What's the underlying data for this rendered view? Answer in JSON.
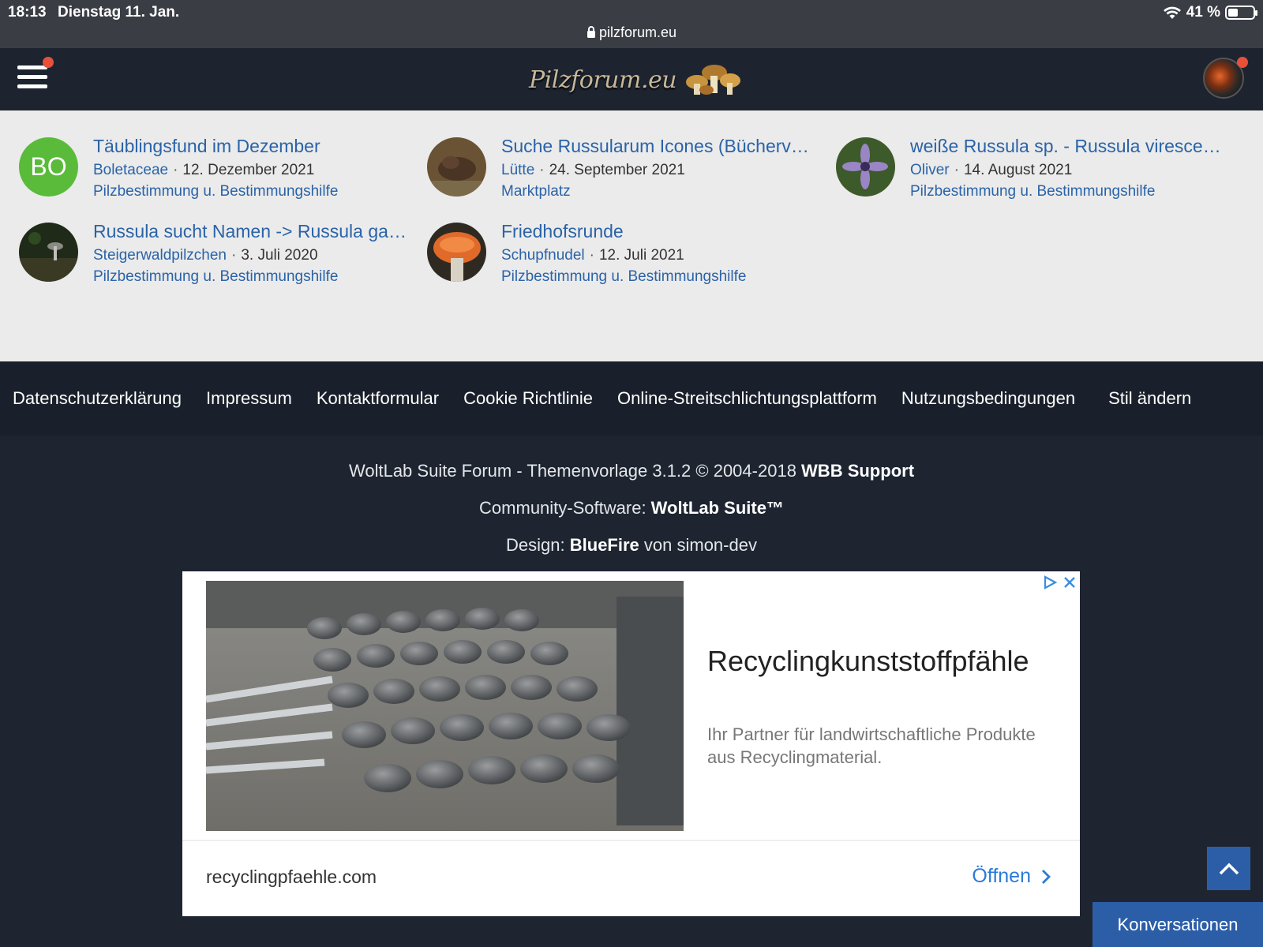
{
  "status_bar": {
    "time": "18:13",
    "date": "Dienstag 11. Jan.",
    "url": "pilzforum.eu",
    "battery": "41 %",
    "battery_level": 0.41
  },
  "header": {
    "logo_text": "Pilzforum.eu"
  },
  "threads": [
    {
      "initials": "BO",
      "title": "Täublingsfund im Dezember",
      "author": "Boletaceae",
      "date": "12. Dezember 2021",
      "board": "Pilzbestimmung u. Bestimmungshilfe"
    },
    {
      "title": "Suche Russularum Icones (Bücherver...",
      "author": "Lütte",
      "date": "24. September 2021",
      "board": "Marktplatz"
    },
    {
      "title": "weiße Russula sp. - Russula virescens...",
      "author": "Oliver",
      "date": "14. August 2021",
      "board": "Pilzbestimmung u. Bestimmungshilfe"
    },
    {
      "title": "Russula sucht Namen -> Russula galo...",
      "author": "Steigerwaldpilzchen",
      "date": "3. Juli 2020",
      "board": "Pilzbestimmung u. Bestimmungshilfe"
    },
    {
      "title": "Friedhofsrunde",
      "author": "Schupfnudel",
      "date": "12. Juli 2021",
      "board": "Pilzbestimmung u. Bestimmungshilfe"
    }
  ],
  "footer_links": [
    "Datenschutzerklärung",
    "Impressum",
    "Kontaktformular",
    "Cookie Richtlinie",
    "Online-Streitschlichtungsplattform",
    "Nutzungsbedingungen",
    "Stil ändern"
  ],
  "copyright": {
    "line1_prefix": "WoltLab Suite Forum - Themenvorlage 3.1.2 © 2004-2018 ",
    "line1_bold": "WBB Support",
    "line2_prefix": "Community-Software: ",
    "line2_bold": "WoltLab Suite™",
    "line3_prefix": "Design: ",
    "line3_bold": "BlueFire",
    "line3_suffix": " von simon-dev"
  },
  "ad": {
    "headline": "Recyclingkunststoffpfähle",
    "description": "Ihr Partner für landwirtschaftliche Produkte aus Recyclingmaterial.",
    "domain": "recyclingpfaehle.com",
    "open_label": "Öffnen"
  },
  "conversations_label": "Konversationen"
}
